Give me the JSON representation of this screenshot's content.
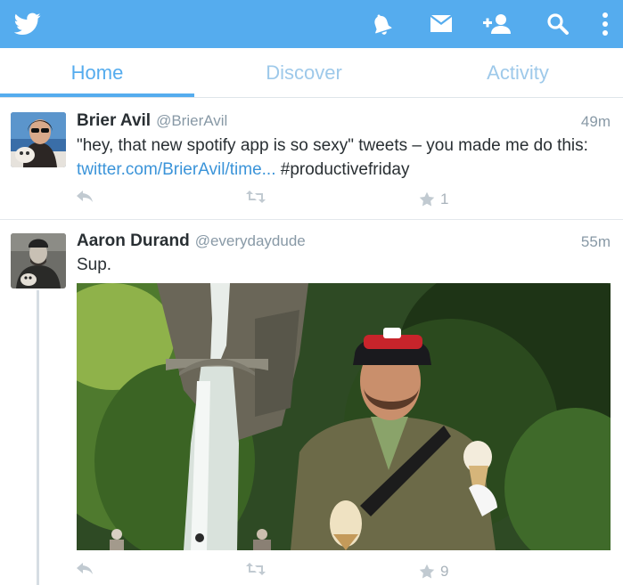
{
  "app": {
    "name": "Twitter"
  },
  "appbar": {
    "icons": [
      "twitter-bird-icon",
      "bell-icon",
      "envelope-icon",
      "add-user-icon",
      "search-icon",
      "overflow-menu-icon"
    ],
    "accent": "#55acee"
  },
  "tabs": [
    {
      "label": "Home",
      "active": true
    },
    {
      "label": "Discover",
      "active": false
    },
    {
      "label": "Activity",
      "active": false
    }
  ],
  "tweets": [
    {
      "name": "Brier Avil",
      "handle": "@BrierAvil",
      "time": "49m",
      "text_before": "\"hey, that new spotify app is so sexy\" tweets – you made me do this: ",
      "link": "twitter.com/BrierAvil/time...",
      "text_after": " #productivefriday",
      "favorites": "1"
    },
    {
      "name": "Aaron Durand",
      "handle": "@everydaydude",
      "time": "55m",
      "text": "Sup.",
      "favorites": "9"
    }
  ]
}
